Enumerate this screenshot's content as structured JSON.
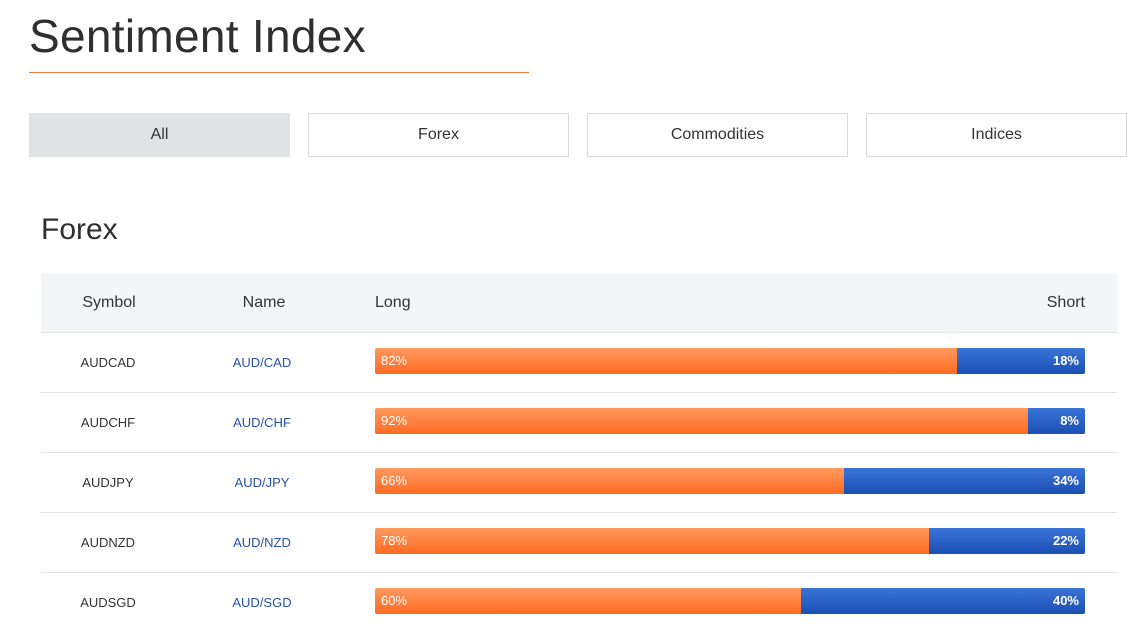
{
  "page": {
    "title": "Sentiment Index",
    "accent_color": "#e67a3c"
  },
  "tabs": [
    {
      "label": "All",
      "active": true
    },
    {
      "label": "Forex",
      "active": false
    },
    {
      "label": "Commodities",
      "active": false
    },
    {
      "label": "Indices",
      "active": false
    }
  ],
  "section": {
    "title": "Forex"
  },
  "table": {
    "headers": {
      "symbol": "Symbol",
      "name": "Name",
      "long": "Long",
      "short": "Short"
    },
    "colors": {
      "long": "#ff7a35",
      "short": "#2458c0",
      "name_link": "#2a50a8"
    },
    "rows": [
      {
        "symbol": "AUDCAD",
        "name": "AUD/CAD",
        "long_pct": 82,
        "short_pct": 18,
        "long_label": "82%",
        "short_label": "18%"
      },
      {
        "symbol": "AUDCHF",
        "name": "AUD/CHF",
        "long_pct": 92,
        "short_pct": 8,
        "long_label": "92%",
        "short_label": "8%"
      },
      {
        "symbol": "AUDJPY",
        "name": "AUD/JPY",
        "long_pct": 66,
        "short_pct": 34,
        "long_label": "66%",
        "short_label": "34%"
      },
      {
        "symbol": "AUDNZD",
        "name": "AUD/NZD",
        "long_pct": 78,
        "short_pct": 22,
        "long_label": "78%",
        "short_label": "22%"
      },
      {
        "symbol": "AUDSGD",
        "name": "AUD/SGD",
        "long_pct": 60,
        "short_pct": 40,
        "long_label": "60%",
        "short_label": "40%"
      }
    ]
  }
}
